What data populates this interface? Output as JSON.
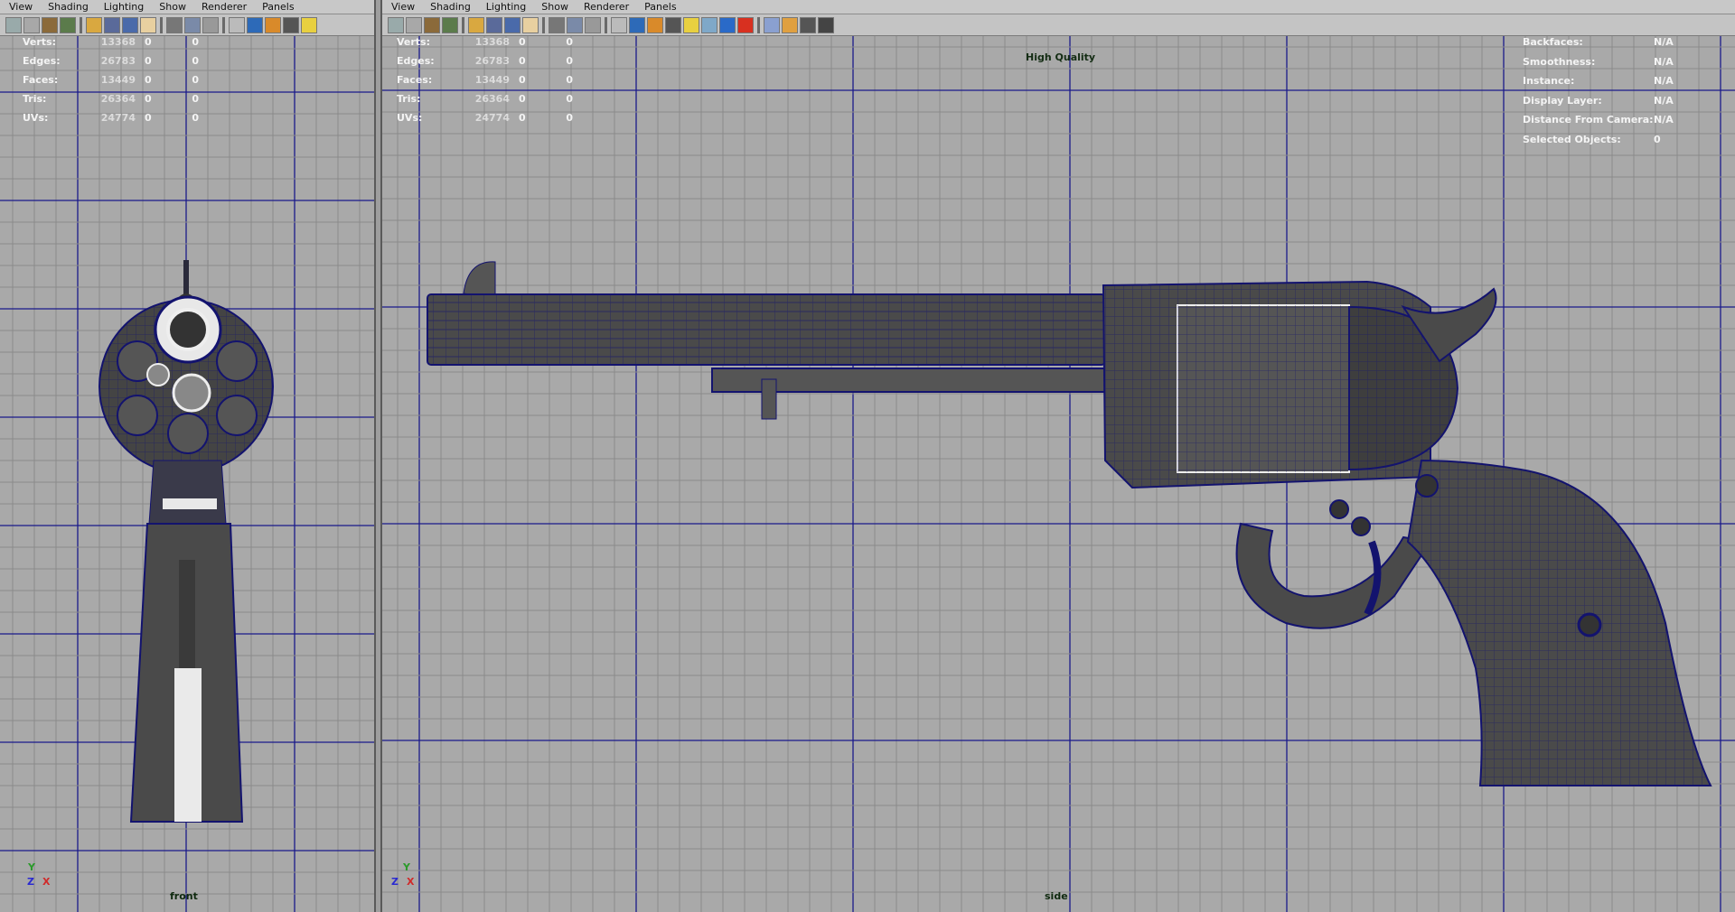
{
  "left_panel": {
    "menu": [
      "View",
      "Shading",
      "Lighting",
      "Show",
      "Renderer",
      "Panels"
    ],
    "hud": [
      {
        "label": "Verts:",
        "v1": "13368",
        "v2": "0",
        "v3": "0"
      },
      {
        "label": "Edges:",
        "v1": "26783",
        "v2": "0",
        "v3": "0"
      },
      {
        "label": "Faces:",
        "v1": "13449",
        "v2": "0",
        "v3": "0"
      },
      {
        "label": "Tris:",
        "v1": "26364",
        "v2": "0",
        "v3": "0"
      },
      {
        "label": "UVs:",
        "v1": "24774",
        "v2": "0",
        "v3": "0"
      }
    ],
    "camera": "front",
    "axis_y": "Y",
    "axis_z": "Z",
    "axis_x": "X"
  },
  "right_panel": {
    "menu": [
      "View",
      "Shading",
      "Lighting",
      "Show",
      "Renderer",
      "Panels"
    ],
    "hud": [
      {
        "label": "Verts:",
        "v1": "13368",
        "v2": "0",
        "v3": "0"
      },
      {
        "label": "Edges:",
        "v1": "26783",
        "v2": "0",
        "v3": "0"
      },
      {
        "label": "Faces:",
        "v1": "13449",
        "v2": "0",
        "v3": "0"
      },
      {
        "label": "Tris:",
        "v1": "26364",
        "v2": "0",
        "v3": "0"
      },
      {
        "label": "UVs:",
        "v1": "24774",
        "v2": "0",
        "v3": "0"
      }
    ],
    "quality": "High Quality",
    "object_info": [
      {
        "label": "Backfaces:",
        "value": "N/A"
      },
      {
        "label": "Smoothness:",
        "value": "N/A"
      },
      {
        "label": "Instance:",
        "value": "N/A"
      },
      {
        "label": "Display Layer:",
        "value": "N/A"
      },
      {
        "label": "Distance From Camera:",
        "value": "N/A"
      },
      {
        "label": "Selected Objects:",
        "value": "0"
      }
    ],
    "camera": "side",
    "axis_y": "Y",
    "axis_z": "Z",
    "axis_x": "X"
  },
  "colors": {
    "viewport_bg": "#a9a9a9",
    "grid_minor": "#8a8a8a",
    "grid_major": "#1a1a8a",
    "model_fill": "#4a4a4a",
    "wire": "#13136e"
  }
}
